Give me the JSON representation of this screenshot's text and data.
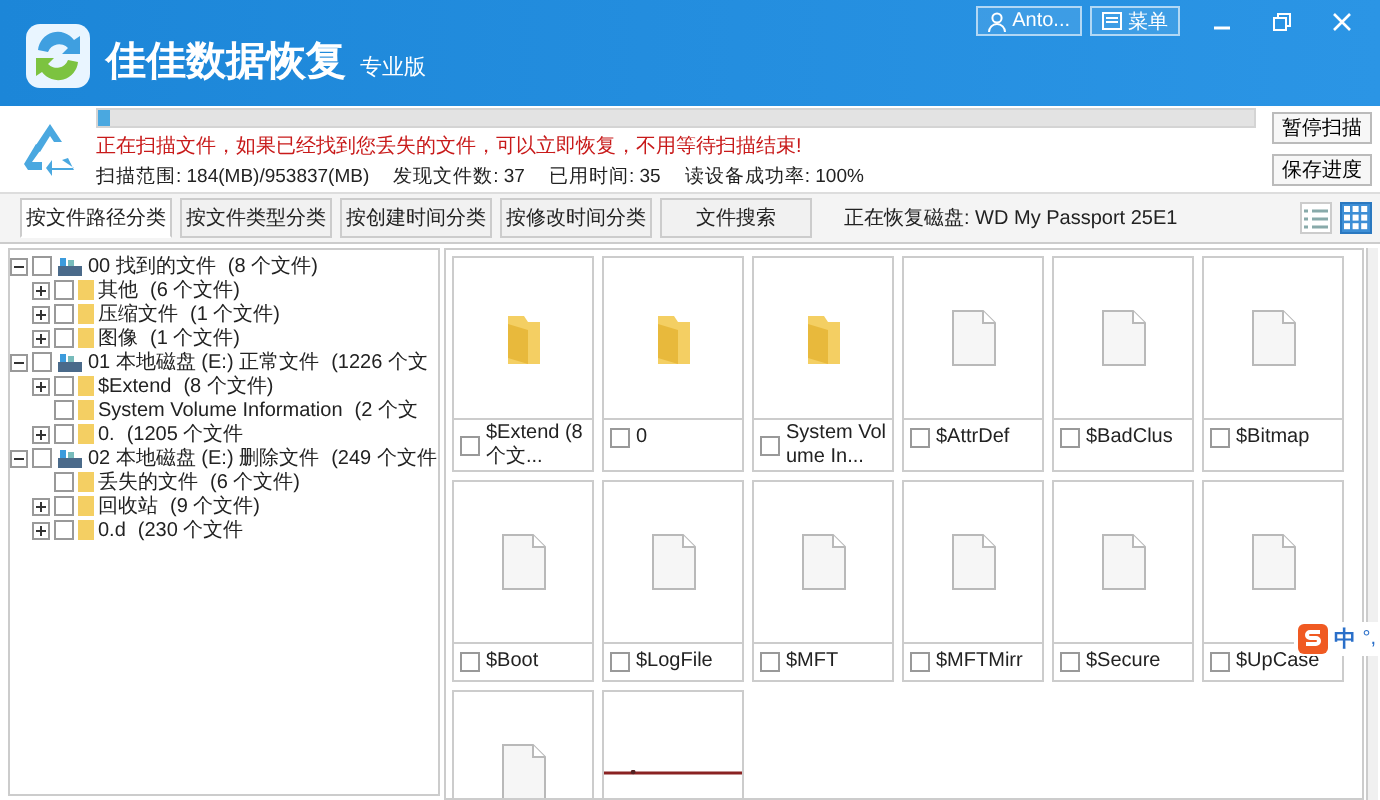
{
  "header": {
    "title": "佳佳数据恢复",
    "edition": "专业版",
    "user": "Anto...",
    "menu": "菜单"
  },
  "scan": {
    "level": 0.01,
    "message": "正在扫描文件，如果已经找到您丢失的文件，可以立即恢复，不用等待扫描结束!",
    "stats": [
      {
        "label": "扫描范围:",
        "value": "184(MB)/953837(MB)"
      },
      {
        "label": "发现文件数:",
        "value": "37"
      },
      {
        "label": "已用时间:",
        "value": "35"
      },
      {
        "label": "读设备成功率:",
        "value": "100%"
      }
    ],
    "buttons": [
      "暂停扫描",
      "保存进度"
    ]
  },
  "tabs": [
    {
      "label": "按文件路径分类",
      "selected": true
    },
    {
      "label": "按文件类型分类",
      "selected": false
    },
    {
      "label": "按创建时间分类",
      "selected": false
    },
    {
      "label": "按修改时间分类",
      "selected": false
    },
    {
      "label": "文件搜索",
      "selected": false
    }
  ],
  "status": "正在恢复磁盘: WD My Passport 25E1",
  "views": [
    {
      "kind": "list",
      "selected": false
    },
    {
      "kind": "grid",
      "selected": true
    }
  ],
  "tree": [
    {
      "kind": "drive",
      "name": "00 找到的文件",
      "count": "(8 个文件)",
      "checked": false,
      "expanded": true,
      "children": [
        {
          "kind": "folder",
          "name": "其他",
          "count": "(6 个文件)",
          "checked": false,
          "expanded": false
        },
        {
          "kind": "folder",
          "name": "压缩文件",
          "count": "(1 个文件)",
          "checked": false,
          "expanded": false
        },
        {
          "kind": "folder",
          "name": "图像",
          "count": "(1 个文件)",
          "checked": false,
          "expanded": false
        }
      ]
    },
    {
      "kind": "drive",
      "name": "01 本地磁盘 (E:) 正常文件",
      "count": "(1226 个文",
      "checked": false,
      "expanded": true,
      "children": [
        {
          "kind": "folder",
          "name": "$Extend",
          "count": "(8 个文件)",
          "checked": false,
          "expanded": false
        },
        {
          "kind": "folder",
          "name": "System Volume Information",
          "count": "(2 个文",
          "checked": false
        },
        {
          "kind": "folder",
          "name": "0.",
          "count": "(1205 个文件",
          "checked": false,
          "expanded": false
        }
      ]
    },
    {
      "kind": "drive",
      "name": "02 本地磁盘 (E:) 删除文件",
      "count": "(249 个文件",
      "checked": false,
      "expanded": true,
      "children": [
        {
          "kind": "folder",
          "name": "丢失的文件",
          "count": "(6 个文件)",
          "checked": false
        },
        {
          "kind": "folder",
          "name": "回收站",
          "count": "(9 个文件)",
          "checked": false,
          "expanded": false
        },
        {
          "kind": "folder",
          "name": "0.d",
          "count": "(230 个文件",
          "checked": false,
          "expanded": false
        }
      ]
    }
  ],
  "files": [
    {
      "kind": "folder",
      "name": "$Extend (8 个文...",
      "checked": false
    },
    {
      "kind": "folder",
      "name": "0",
      "checked": false
    },
    {
      "kind": "folder",
      "name": "System Volume In...",
      "checked": false
    },
    {
      "kind": "file",
      "name": "$AttrDef",
      "checked": false
    },
    {
      "kind": "file",
      "name": "$BadClus",
      "checked": false
    },
    {
      "kind": "file",
      "name": "$Bitmap",
      "checked": false
    },
    {
      "kind": "file",
      "name": "$Boot",
      "checked": false
    },
    {
      "kind": "file",
      "name": "$LogFile",
      "checked": false
    },
    {
      "kind": "file",
      "name": "$MFT",
      "checked": false
    },
    {
      "kind": "file",
      "name": "$MFTMirr",
      "checked": false
    },
    {
      "kind": "file",
      "name": "$Secure",
      "checked": false
    },
    {
      "kind": "file",
      "name": "$UpCase",
      "checked": false
    },
    {
      "kind": "file"
    },
    {
      "kind": "image"
    }
  ],
  "ime_toolbar": {
    "label": "中",
    "marks": "°,"
  }
}
